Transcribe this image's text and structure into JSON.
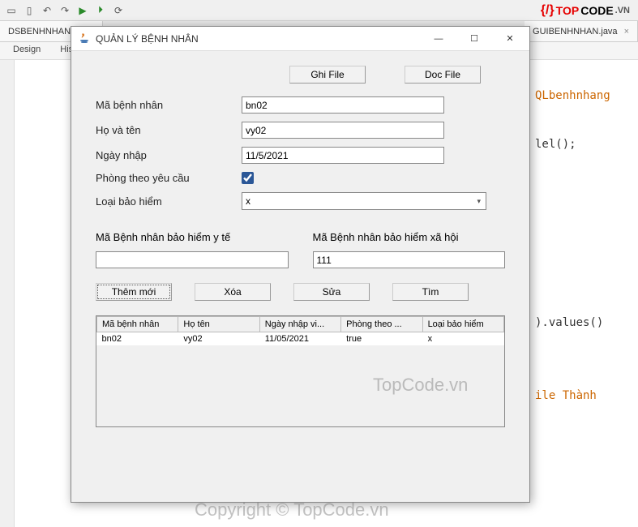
{
  "ide": {
    "tab_left": "DSBENHNHAN.j...",
    "tab_right": "GUIBENHNHAN.java",
    "subtabs": {
      "design": "Design",
      "history": "Histo..."
    },
    "code_frag1": "QLbenhnhang",
    "code_frag2": "lel();",
    "code_frag3": ").values()",
    "code_frag4": "ile Thành"
  },
  "logo": {
    "top": "TOP",
    "code": "CODE",
    "vn": ".VN"
  },
  "watermark": {
    "wm1": "TopCode.vn",
    "wm2": "Copyright © TopCode.vn"
  },
  "window": {
    "title": "QUẢN LÝ BỆNH NHÂN",
    "buttons": {
      "ghi_file": "Ghi File",
      "doc_file": "Doc File"
    },
    "fields": {
      "ma_label": "Mã bệnh nhân",
      "ma_value": "bn02",
      "ten_label": "Họ và tên",
      "ten_value": "vy02",
      "ngay_label": "Ngày nhập",
      "ngay_value": "11/5/2021",
      "phong_label": "Phòng theo yêu cầu",
      "phong_checked": true,
      "bh_label": "Loại bảo hiểm",
      "bh_value": "x"
    },
    "sub": {
      "yte_label": "Mã Bệnh nhân bảo hiểm y tế",
      "yte_value": "",
      "xh_label": "Mã Bệnh nhân bảo hiểm xã hội",
      "xh_value": "111"
    },
    "actions": {
      "them": "Thêm mới",
      "xoa": "Xóa",
      "sua": "Sửa",
      "tim": "Tìm"
    },
    "table": {
      "headers": [
        "Mã bệnh nhân",
        "Họ tên",
        "Ngày nhập vi...",
        "Phòng theo ...",
        "Loại bảo hiểm"
      ],
      "rows": [
        {
          "ma": "bn02",
          "ten": "vy02",
          "ngay": "11/05/2021",
          "phong": "true",
          "bh": "x"
        }
      ]
    }
  }
}
